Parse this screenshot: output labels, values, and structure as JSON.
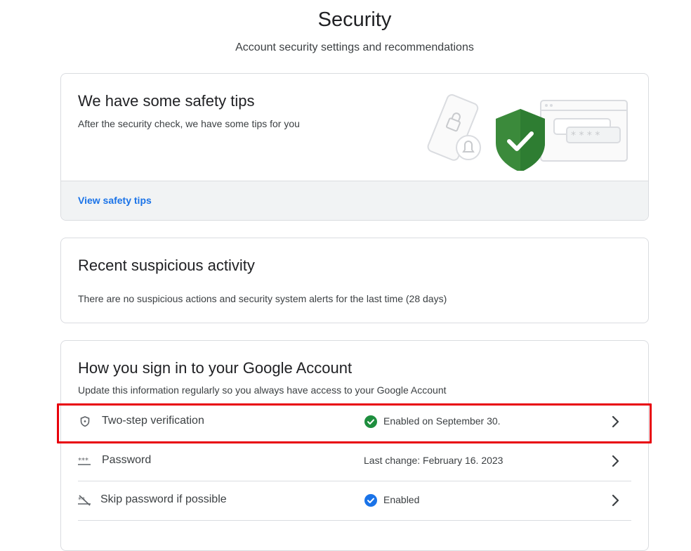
{
  "header": {
    "title": "Security",
    "subtitle": "Account security settings and recommendations"
  },
  "safety_tips": {
    "title": "We have some safety tips",
    "description": "After the security check, we have some tips for you",
    "link_label": "View safety tips",
    "link_color": "#1a73e8",
    "illustration_icon": "shield-check-icon"
  },
  "suspicious_activity": {
    "title": "Recent suspicious activity",
    "description": "There are no suspicious actions and security system alerts for the last time (28 days)"
  },
  "signin": {
    "title": "How you sign in to your Google Account",
    "description": "Update this information regularly so you always have access to your Google Account",
    "rows": [
      {
        "label": "Two-step verification",
        "icon": "shield-icon",
        "status": "Enabled on September 30.",
        "status_icon": "green-check-icon",
        "status_color": "#1e8e3e",
        "highlighted": true
      },
      {
        "label": "Password",
        "icon": "password-dots-icon",
        "status": "Last change: February 16. 2023",
        "status_icon": ""
      },
      {
        "label": "Skip password if possible",
        "icon": "passkey-off-icon",
        "status": "Enabled",
        "status_icon": "blue-check-icon",
        "status_color": "#1a73e8"
      }
    ]
  },
  "colors": {
    "highlight_border": "#e8000b",
    "shield_green": "#34a853"
  }
}
